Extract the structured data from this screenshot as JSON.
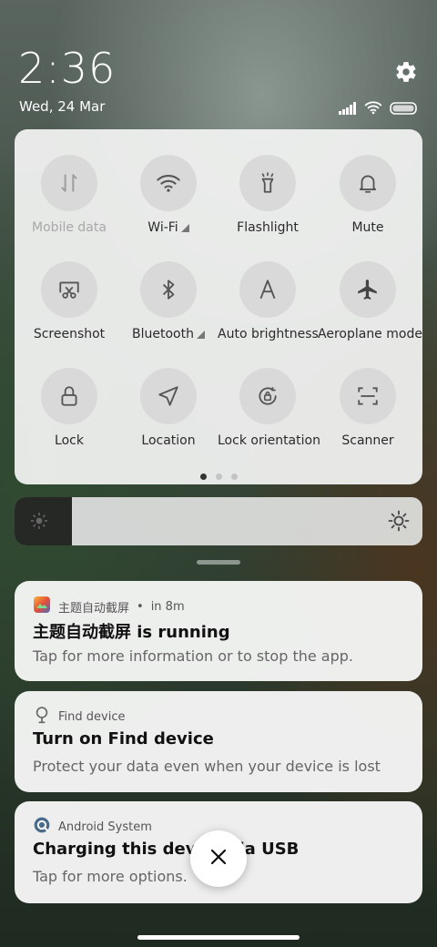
{
  "status": {
    "time": "2:36",
    "date": "Wed, 24 Mar",
    "icons": [
      "signal-icon",
      "wifi-icon",
      "battery-icon"
    ]
  },
  "quick_settings": {
    "tiles": [
      {
        "label": "Mobile data",
        "icon": "mobile-data-icon",
        "enabled": false
      },
      {
        "label": "Wi-Fi",
        "icon": "wifi-icon",
        "enabled": true,
        "has_arrow": true
      },
      {
        "label": "Flashlight",
        "icon": "flashlight-icon",
        "enabled": true
      },
      {
        "label": "Mute",
        "icon": "bell-icon",
        "enabled": true
      },
      {
        "label": "Screenshot",
        "icon": "screenshot-icon",
        "enabled": true
      },
      {
        "label": "Bluetooth",
        "icon": "bluetooth-icon",
        "enabled": true,
        "has_arrow": true
      },
      {
        "label": "Auto brightness",
        "icon": "auto-brightness-icon",
        "enabled": true
      },
      {
        "label": "Aeroplane mode",
        "icon": "airplane-icon",
        "enabled": true
      },
      {
        "label": "Lock",
        "icon": "lock-icon",
        "enabled": true
      },
      {
        "label": "Location",
        "icon": "location-icon",
        "enabled": true
      },
      {
        "label": "Lock orientation",
        "icon": "rotation-lock-icon",
        "enabled": true
      },
      {
        "label": "Scanner",
        "icon": "scanner-icon",
        "enabled": true
      }
    ],
    "page_count": 3,
    "current_page": 1
  },
  "brightness": {
    "level": 0.14
  },
  "notifications": [
    {
      "app": "主题自动截屏",
      "time": "in 8m",
      "title": "主题自动截屏 is running",
      "body": "Tap for more information or to stop the app.",
      "icon": "theme-app-icon"
    },
    {
      "app": "Find device",
      "time": "",
      "title": "Turn on Find device",
      "body": "Protect your data even when your device is lost",
      "icon": "find-device-icon"
    },
    {
      "app": "Android System",
      "time": "",
      "title": "Charging this device via USB",
      "body": "Tap for more options.",
      "icon": "android-system-icon"
    }
  ],
  "colors": {
    "panel": "#f0f1f0",
    "tile": "#d8d9d8",
    "accent_dark": "#262826"
  }
}
